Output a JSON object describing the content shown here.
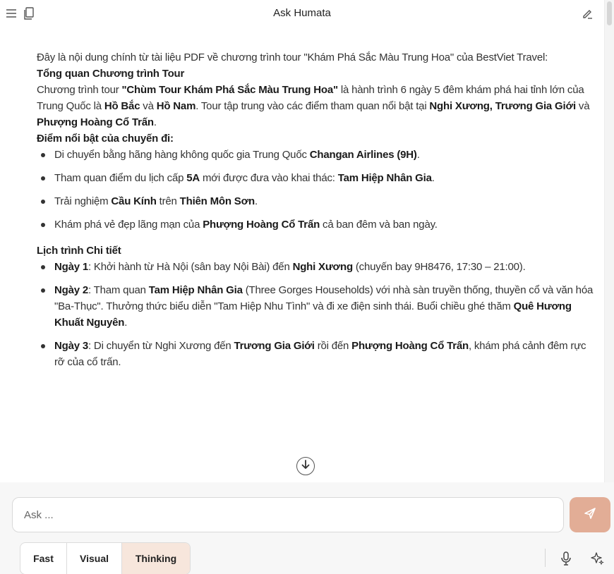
{
  "header": {
    "title": "Ask Humata",
    "menu_icon": "menu-icon",
    "documents_icon": "documents-icon",
    "edit_icon": "edit-icon"
  },
  "content": {
    "intro": "Đây là nội dung chính từ tài liệu PDF về chương trình tour \"Khám Phá Sắc Màu Trung Hoa\" của BestViet Travel:",
    "overview_heading": "Tổng quan Chương trình Tour",
    "overview": {
      "t1": "Chương trình tour ",
      "b1": "\"Chùm Tour Khám Phá Sắc Màu Trung Hoa\"",
      "t2": " là hành trình 6 ngày 5 đêm khám phá hai tỉnh lớn của Trung Quốc là ",
      "b2": "Hồ Bắc",
      "t3": " và ",
      "b3": "Hồ Nam",
      "t4": ". Tour tập trung vào các điểm tham quan nổi bật tại ",
      "b4": "Nghi Xương, Trương Gia Giới",
      "t5": " và ",
      "b5": "Phượng Hoàng Cổ Trấn",
      "t6": "."
    },
    "highlights_heading": "Điểm nổi bật của chuyến đi:",
    "highlights": [
      {
        "t1": "Di chuyển bằng hãng hàng không quốc gia Trung Quốc ",
        "b1": "Changan Airlines (9H)",
        "t2": "."
      },
      {
        "t1": "Tham quan điểm du lịch cấp ",
        "b1": "5A",
        "t2": " mới được đưa vào khai thác: ",
        "b2": "Tam Hiệp Nhân Gia",
        "t3": "."
      },
      {
        "t1": "Trải nghiệm ",
        "b1": "Cầu Kính",
        "t2": " trên ",
        "b2": "Thiên Môn Sơn",
        "t3": "."
      },
      {
        "t1": "Khám phá vẻ đẹp lãng mạn của ",
        "b1": "Phượng Hoàng Cổ Trấn",
        "t2": " cả ban đêm và ban ngày."
      }
    ],
    "itinerary_heading": "Lịch trình Chi tiết",
    "itinerary": [
      {
        "b1": "Ngày 1",
        "t1": ": Khởi hành từ Hà Nội (sân bay Nội Bài) đến ",
        "b2": "Nghi Xương",
        "t2": " (chuyến bay 9H8476, 17:30 – 21:00)."
      },
      {
        "b1": "Ngày 2",
        "t1": ": Tham quan ",
        "b2": "Tam Hiệp Nhân Gia",
        "t2": " (Three Gorges Households) với nhà sàn truyền thống, thuyền cổ và văn hóa \"Ba-Thục\". Thưởng thức biểu diễn \"Tam Hiệp Nhu Tình\" và đi xe điện sinh thái. Buổi chiều ghé thăm ",
        "b3": "Quê Hương Khuất Nguyên",
        "t3": "."
      },
      {
        "b1": "Ngày 3",
        "t1": ": Di chuyển từ Nghi Xương đến ",
        "b2": "Trương Gia Giới",
        "t2": " rồi đến ",
        "b3": "Phượng Hoàng Cổ Trấn",
        "t3": ", khám phá cảnh đêm rực rỡ của cổ trấn."
      }
    ]
  },
  "composer": {
    "placeholder": "Ask ...",
    "send_icon": "send-icon",
    "modes": [
      {
        "label": "Fast",
        "active": false
      },
      {
        "label": "Visual",
        "active": false
      },
      {
        "label": "Thinking",
        "active": true
      }
    ],
    "mic_icon": "microphone-icon",
    "sparkle_icon": "sparkle-icon"
  },
  "colors": {
    "accent": "#e2ad96",
    "active_mode_bg": "#f7e6dc"
  }
}
